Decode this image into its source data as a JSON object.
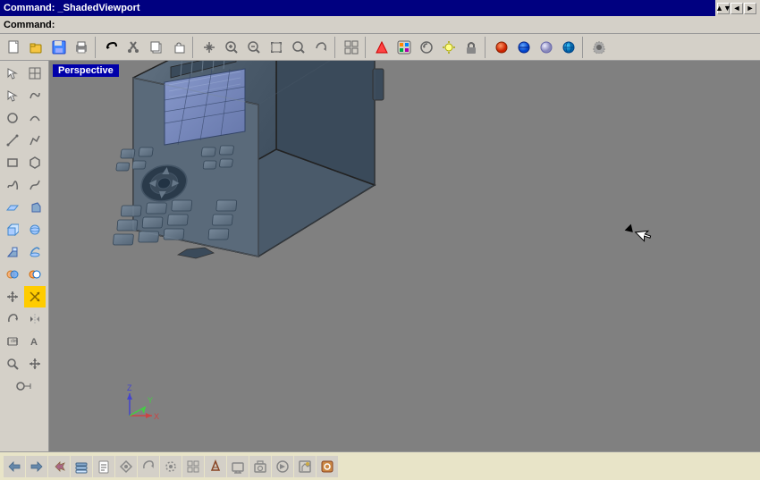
{
  "titlebar": {
    "title": "Command: _ShadedViewport",
    "controls": [
      "▲▼",
      "─",
      "□",
      "×"
    ]
  },
  "commandbar": {
    "label": "Command:",
    "value": ""
  },
  "viewport": {
    "perspective_label": "Perspective"
  },
  "toolbar": {
    "main_buttons": [
      "📁",
      "💾",
      "🖨",
      "✂",
      "📋",
      "🔁",
      "✋",
      "⊕",
      "🔍",
      "🔍",
      "↻",
      "◱",
      "⚡",
      "📤",
      "🔄",
      "○",
      "◐",
      "◑",
      "🎨",
      "⚙"
    ],
    "scroll_controls": [
      "▲▼",
      "◄",
      "►"
    ]
  },
  "bottom_toolbar": {
    "buttons": [
      "◄",
      "▲",
      "▼",
      "►",
      "↗",
      "↙",
      "↔",
      "↕",
      "⊙",
      "⊞",
      "◈",
      "◉",
      "⬡",
      "✦",
      "✧",
      "⬢",
      "◆",
      "◇",
      "○",
      "●"
    ]
  }
}
